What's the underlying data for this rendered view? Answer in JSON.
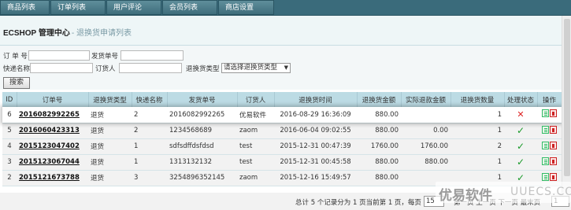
{
  "tabs": [
    "商品列表",
    "订单列表",
    "用户评论",
    "会员列表",
    "商店设置"
  ],
  "header": {
    "title": "ECSHOP 管理中心",
    "subtitle": "- 退换货申请列表"
  },
  "search": {
    "order_sn_label": "订 单 号",
    "return_sn_label": "发货单号",
    "express_label": "快递名称",
    "consignee_label": "订货人",
    "type_label": "退换货类型",
    "type_select": "请选择退换货类型",
    "search_button": "搜索"
  },
  "table": {
    "headers": [
      "ID",
      "订单号",
      "退换货类型",
      "快递名称",
      "发货单号",
      "订货人",
      "退换货时间",
      "退换货金额",
      "实际退款金额",
      "退换货数量",
      "处理状态",
      "操作"
    ],
    "rows": [
      {
        "id": "6",
        "order_sn": "2016082992265",
        "type": "退货",
        "express": "2",
        "invoice": "2016082992265",
        "consignee": "优易软件",
        "time": "2016-08-29 16:36:09",
        "amount": "880.00",
        "refund": "",
        "qty": "1",
        "status": "rejected"
      },
      {
        "id": "5",
        "order_sn": "2016060423313",
        "type": "退货",
        "express": "2",
        "invoice": "1234568689",
        "consignee": "zaom",
        "time": "2016-06-04 09:02:55",
        "amount": "880.00",
        "refund": "0.00",
        "qty": "1",
        "status": "done"
      },
      {
        "id": "4",
        "order_sn": "2015123047402",
        "type": "退货",
        "express": "1",
        "invoice": "sdfsdffdsfdsd",
        "consignee": "test",
        "time": "2015-12-31 00:47:39",
        "amount": "1760.00",
        "refund": "1760.00",
        "qty": "2",
        "status": "done"
      },
      {
        "id": "3",
        "order_sn": "2015123067044",
        "type": "退货",
        "express": "1",
        "invoice": "1313132132",
        "consignee": "test",
        "time": "2015-12-31 00:45:58",
        "amount": "880.00",
        "refund": "880.00",
        "qty": "1",
        "status": "done"
      },
      {
        "id": "2",
        "order_sn": "2015121673788",
        "type": "退货",
        "express": "3",
        "invoice": "3254896352145",
        "consignee": "zaom",
        "time": "2015-12-16 15:49:57",
        "amount": "880.00",
        "refund": "",
        "qty": "1",
        "status": "done"
      }
    ]
  },
  "footer": {
    "info": "总计 5 个记录分为 1 页当前第 1 页，每页",
    "per_page": "15",
    "nav": "第一页 上一页 下一页 最末页",
    "page": "1"
  },
  "watermark": {
    "text_cn": "优易软件",
    "text_en": "UUECS.COM"
  },
  "colors": {
    "nav_bg": "#3a6b7b",
    "table_header": "#bcdbe4",
    "reject": "#d22222",
    "ok": "#1a9a2a"
  }
}
